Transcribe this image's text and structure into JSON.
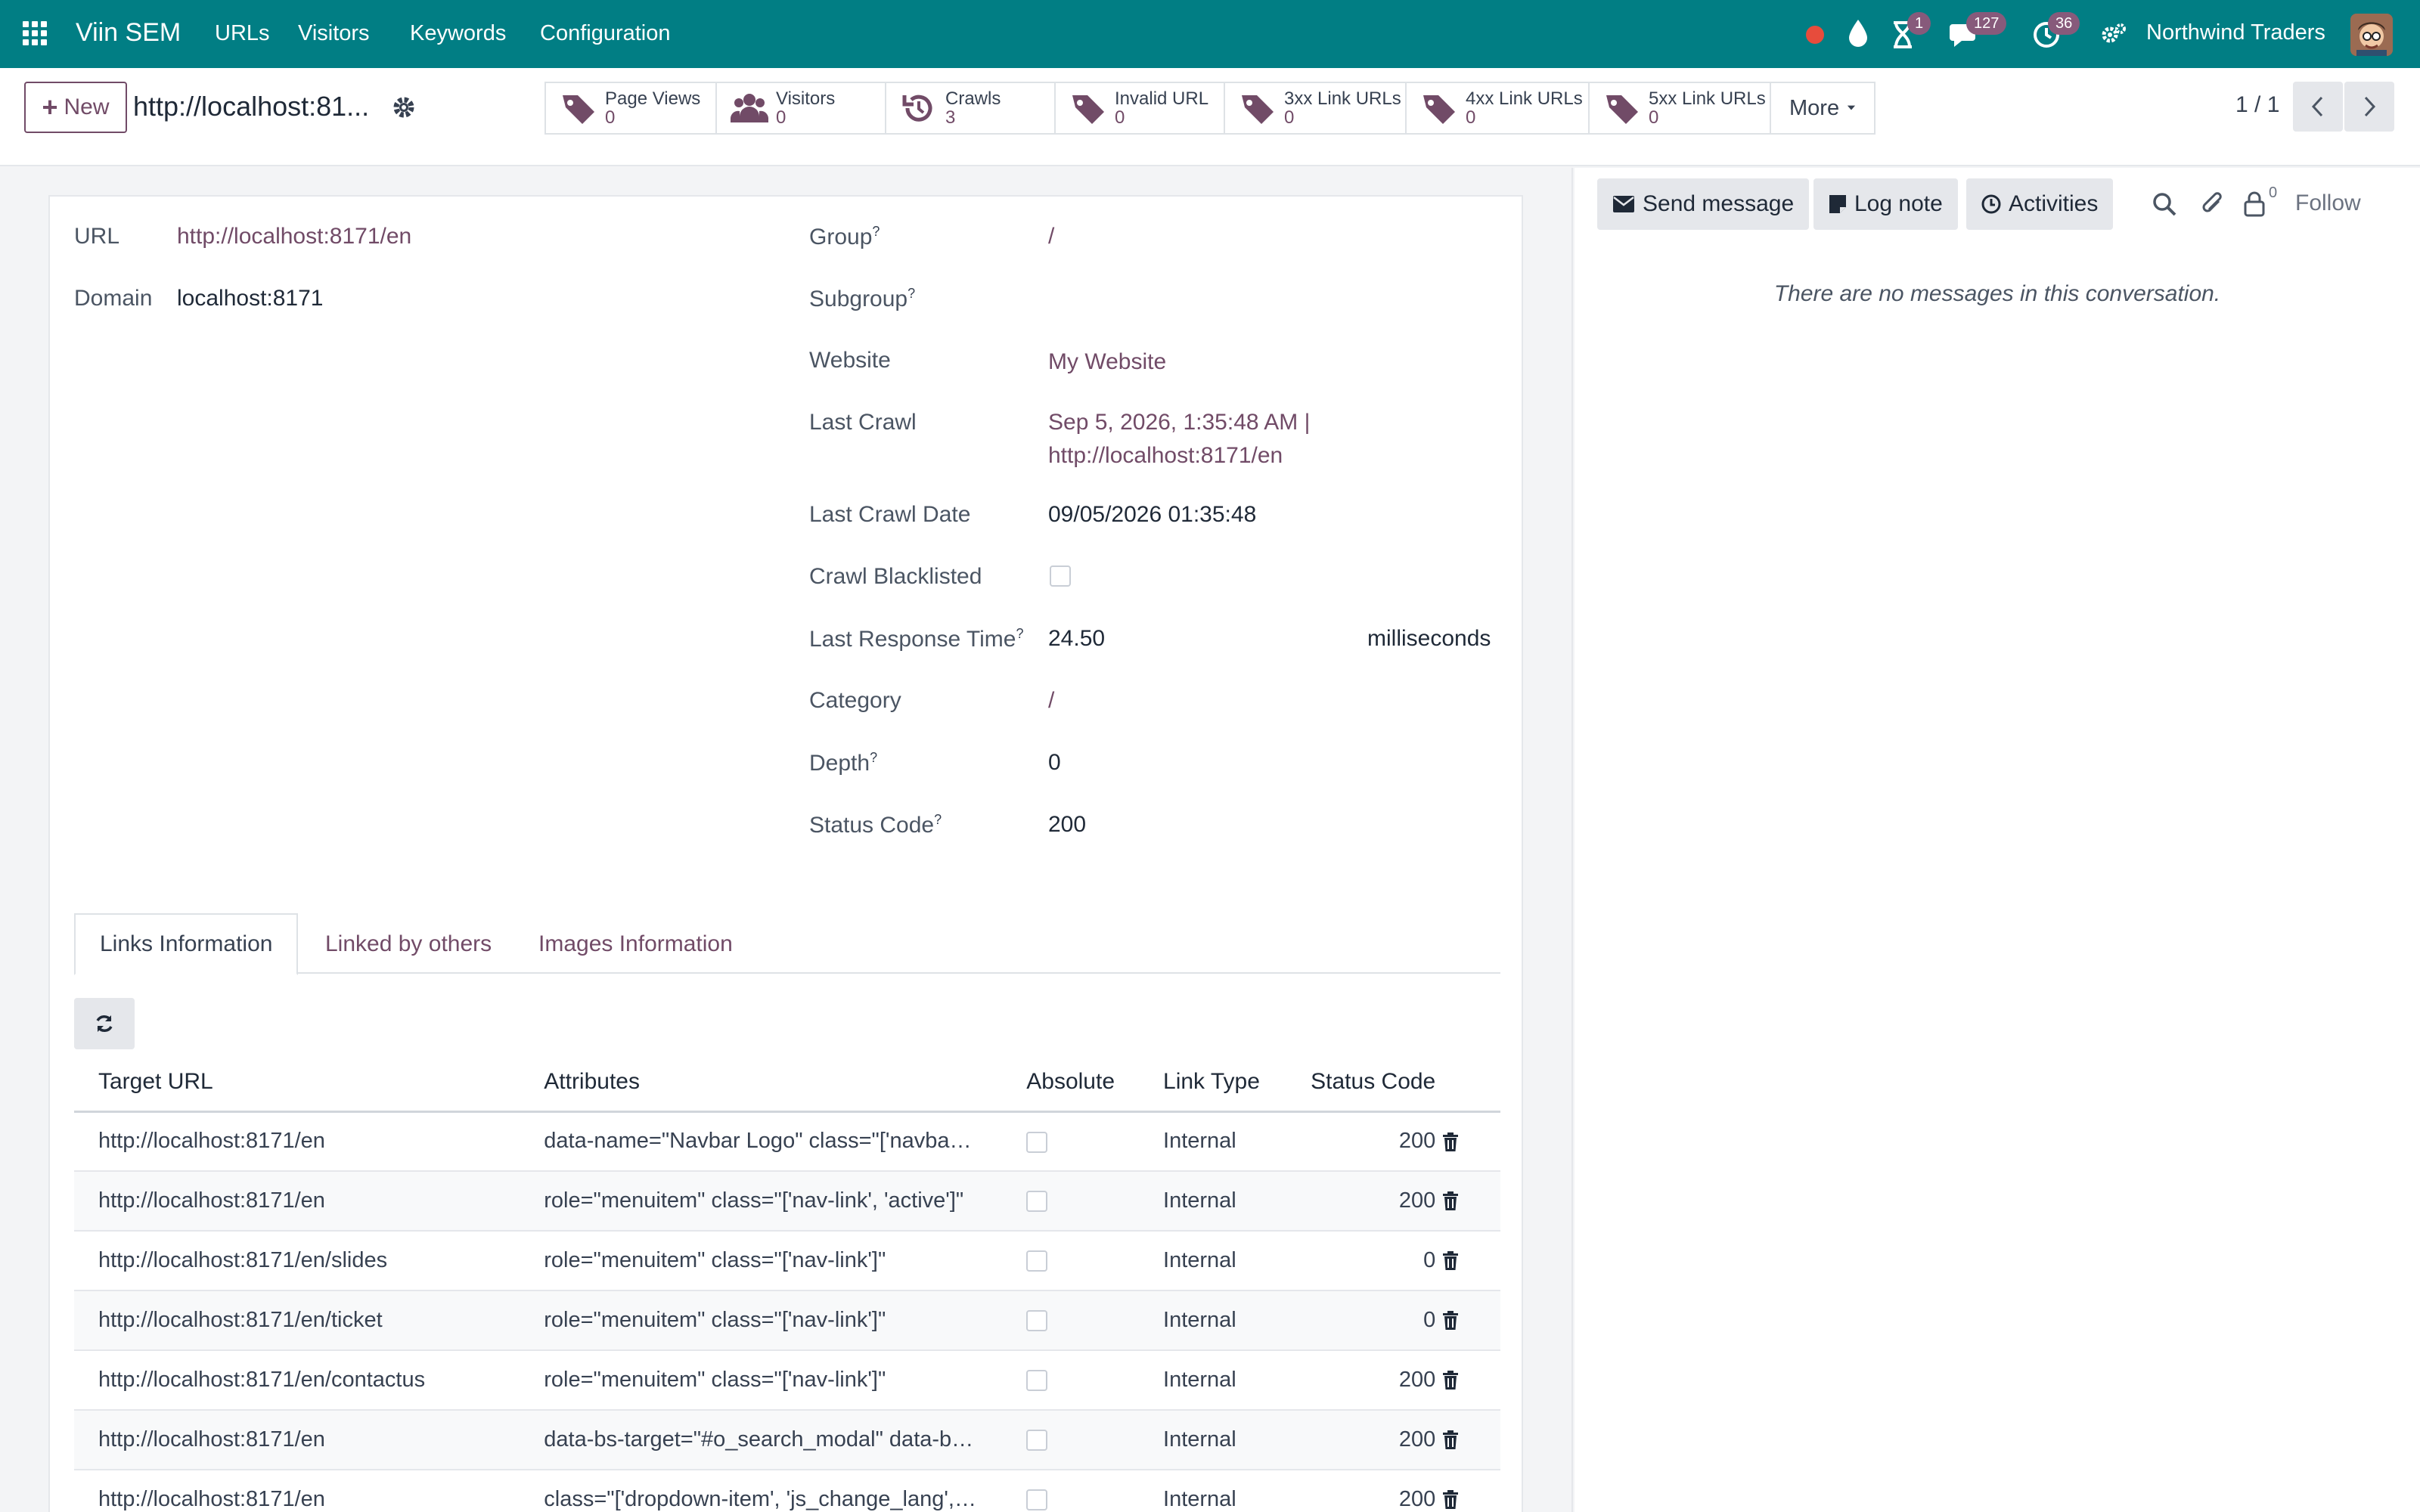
{
  "navbar": {
    "brand": "Viin SEM",
    "menu": [
      "URLs",
      "Visitors",
      "Keywords",
      "Configuration"
    ],
    "activity_badge": "1",
    "messages_badge": "127",
    "clock_badge": "36",
    "company": "Northwind Traders",
    "colors": {
      "bar": "#017e84",
      "badge": "#875a7b",
      "recording_dot": "#e74c3c"
    }
  },
  "control": {
    "new_label": "New",
    "record_title": "http://localhost:81...",
    "smart_buttons": [
      {
        "label": "Page Views",
        "value": "0",
        "icon": "tag-icon"
      },
      {
        "label": "Visitors",
        "value": "0",
        "icon": "users-icon"
      },
      {
        "label": "Crawls",
        "value": "3",
        "icon": "history-icon"
      },
      {
        "label": "Invalid URL",
        "value": "0",
        "icon": "tag-icon"
      },
      {
        "label": "3xx Link URLs",
        "value": "0",
        "icon": "tag-icon"
      },
      {
        "label": "4xx Link URLs",
        "value": "0",
        "icon": "tag-icon"
      },
      {
        "label": "5xx Link URLs",
        "value": "0",
        "icon": "tag-icon"
      }
    ],
    "more_label": "More",
    "pager": "1 / 1"
  },
  "form": {
    "left": {
      "url_label": "URL",
      "url_value": "http://localhost:8171/en",
      "domain_label": "Domain",
      "domain_value": "localhost:8171"
    },
    "right": {
      "group_label": "Group",
      "group_value": "/",
      "subgroup_label": "Subgroup",
      "subgroup_value": "",
      "website_label": "Website",
      "website_value": "My Website",
      "last_crawl_label": "Last Crawl",
      "last_crawl_line1": "Sep 5, 2026, 1:35:48 AM |",
      "last_crawl_line2": "http://localhost:8171/en",
      "last_crawl_date_label": "Last Crawl Date",
      "last_crawl_date_value": "09/05/2026 01:35:48",
      "crawl_blacklisted_label": "Crawl Blacklisted",
      "crawl_blacklisted_value": false,
      "last_response_time_label": "Last Response Time",
      "last_response_time_value": "24.50",
      "last_response_time_unit": "milliseconds",
      "category_label": "Category",
      "category_value": "/",
      "depth_label": "Depth",
      "depth_value": "0",
      "status_code_label": "Status Code",
      "status_code_value": "200"
    },
    "help_mark": "?"
  },
  "tabs": [
    "Links Information",
    "Linked by others",
    "Images Information"
  ],
  "links_table": {
    "headers": [
      "Target URL",
      "Attributes",
      "Absolute",
      "Link Type",
      "Status Code"
    ],
    "rows": [
      {
        "target": "http://localhost:8171/en",
        "attributes": "data-name=\"Navbar Logo\" class=\"['navbar-br...",
        "absolute": false,
        "type": "Internal",
        "status": "200"
      },
      {
        "target": "http://localhost:8171/en",
        "attributes": "role=\"menuitem\" class=\"['nav-link', 'active']\"",
        "absolute": false,
        "type": "Internal",
        "status": "200"
      },
      {
        "target": "http://localhost:8171/en/slides",
        "attributes": "role=\"menuitem\" class=\"['nav-link']\"",
        "absolute": false,
        "type": "Internal",
        "status": "0"
      },
      {
        "target": "http://localhost:8171/en/ticket",
        "attributes": "role=\"menuitem\" class=\"['nav-link']\"",
        "absolute": false,
        "type": "Internal",
        "status": "0"
      },
      {
        "target": "http://localhost:8171/en/contactus",
        "attributes": "role=\"menuitem\" class=\"['nav-link']\"",
        "absolute": false,
        "type": "Internal",
        "status": "200"
      },
      {
        "target": "http://localhost:8171/en",
        "attributes": "data-bs-target=\"#o_search_modal\" data-bs-t...",
        "absolute": false,
        "type": "Internal",
        "status": "200"
      },
      {
        "target": "http://localhost:8171/en",
        "attributes": "class=\"['dropdown-item', 'js_change_lang', 'a...",
        "absolute": false,
        "type": "Internal",
        "status": "200"
      }
    ]
  },
  "chatter": {
    "send_message": "Send message",
    "log_note": "Log note",
    "activities": "Activities",
    "followers_count": "0",
    "follow": "Follow",
    "empty_text": "There are no messages in this conversation."
  }
}
